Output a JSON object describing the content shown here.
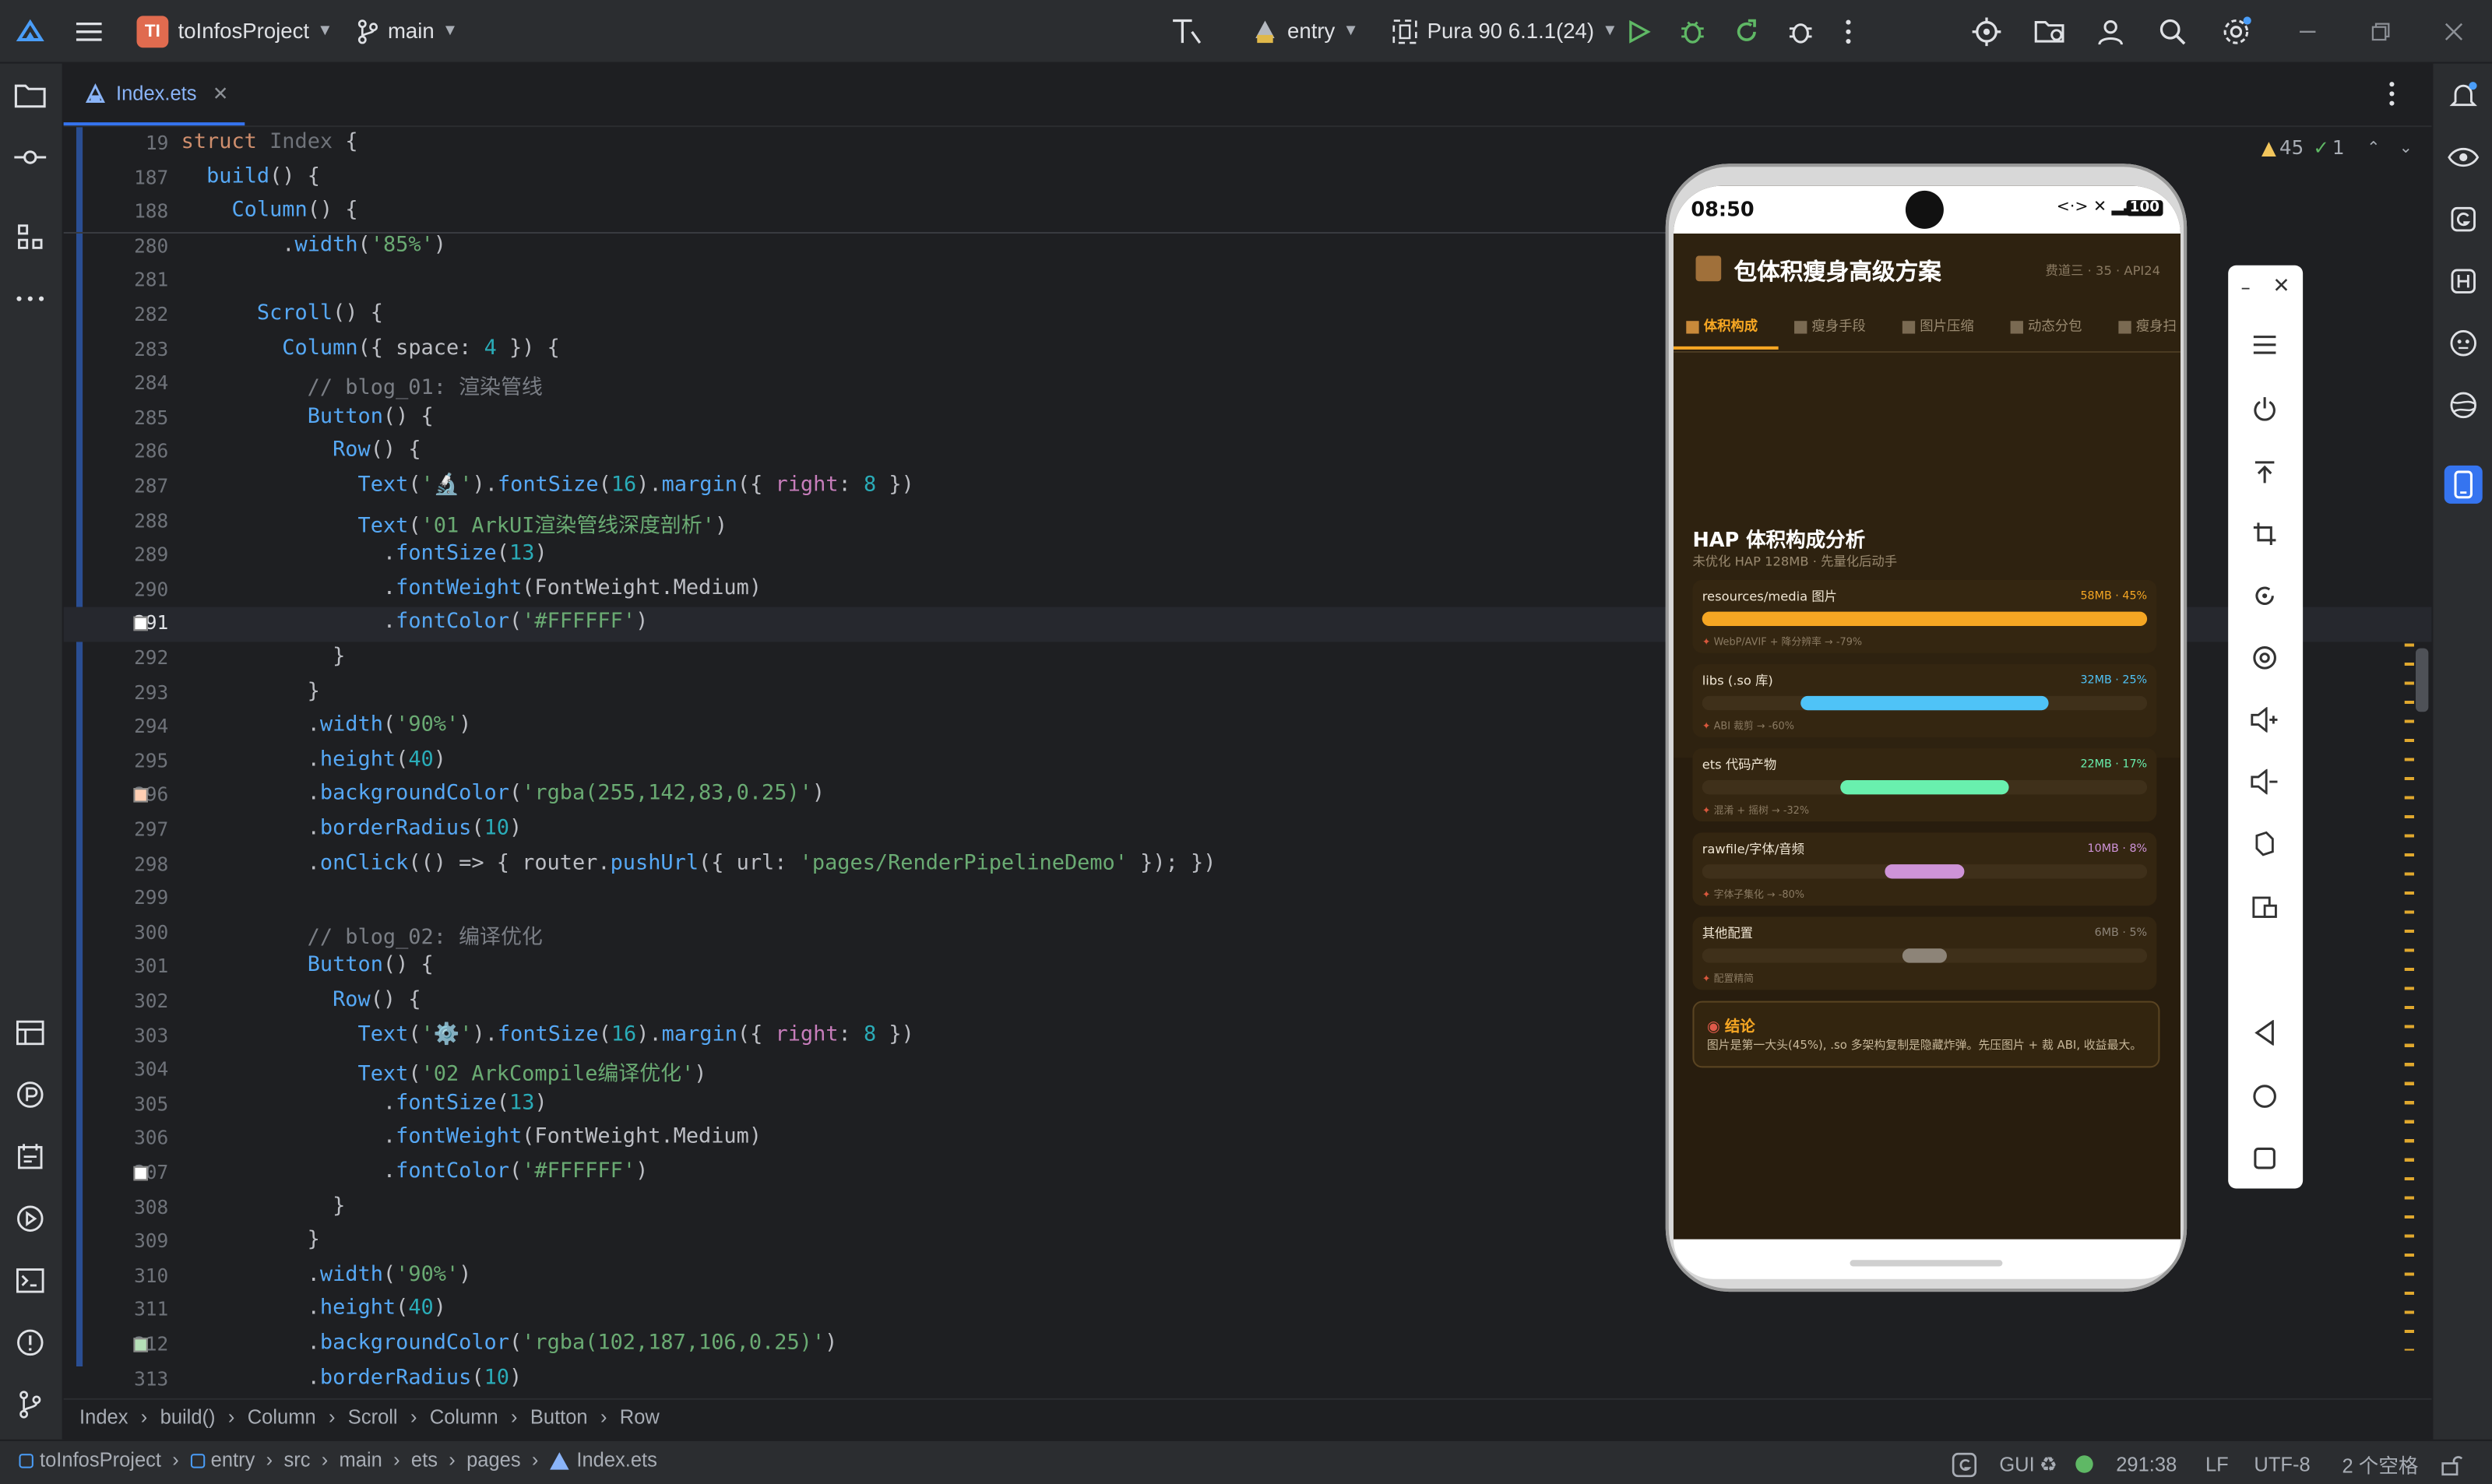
{
  "titlebar": {
    "project_badge": "TI",
    "project_name": "toInfosProject",
    "branch": "main",
    "run_config": "entry",
    "device": "Pura 90 6.1.1(24)"
  },
  "tab": {
    "filename": "Index.ets"
  },
  "inspections": {
    "warnings": "45",
    "weak_warnings": "1"
  },
  "code": {
    "lines": [
      {
        "n": "19",
        "text": "struct Index {"
      },
      {
        "n": "187",
        "text": "  build() {"
      },
      {
        "n": "188",
        "text": "    Column() {"
      },
      {
        "n": "280",
        "text": "        .width('85%')"
      },
      {
        "n": "281",
        "text": ""
      },
      {
        "n": "282",
        "text": "      Scroll() {"
      },
      {
        "n": "283",
        "text": "        Column({ space: 4 }) {"
      },
      {
        "n": "284",
        "text": "          // blog_01: 渲染管线"
      },
      {
        "n": "285",
        "text": "          Button() {"
      },
      {
        "n": "286",
        "text": "            Row() {"
      },
      {
        "n": "287",
        "text": "              Text('🔬').fontSize(16).margin({ right: 8 })"
      },
      {
        "n": "288",
        "text": "              Text('01 ArkUI渲染管线深度剖析')"
      },
      {
        "n": "289",
        "text": "                .fontSize(13)"
      },
      {
        "n": "290",
        "text": "                .fontWeight(FontWeight.Medium)"
      },
      {
        "n": "291",
        "text": "                .fontColor('#FFFFFF')"
      },
      {
        "n": "292",
        "text": "            }"
      },
      {
        "n": "293",
        "text": "          }"
      },
      {
        "n": "294",
        "text": "          .width('90%')"
      },
      {
        "n": "295",
        "text": "          .height(40)"
      },
      {
        "n": "296",
        "text": "          .backgroundColor('rgba(255,142,83,0.25)')"
      },
      {
        "n": "297",
        "text": "          .borderRadius(10)"
      },
      {
        "n": "298",
        "text": "          .onClick(() => { router.pushUrl({ url: 'pages/RenderPipelineDemo' }); })"
      },
      {
        "n": "299",
        "text": ""
      },
      {
        "n": "300",
        "text": "          // blog_02: 编译优化"
      },
      {
        "n": "301",
        "text": "          Button() {"
      },
      {
        "n": "302",
        "text": "            Row() {"
      },
      {
        "n": "303",
        "text": "              Text('⚙️').fontSize(16).margin({ right: 8 })"
      },
      {
        "n": "304",
        "text": "              Text('02 ArkCompile编译优化')"
      },
      {
        "n": "305",
        "text": "                .fontSize(13)"
      },
      {
        "n": "306",
        "text": "                .fontWeight(FontWeight.Medium)"
      },
      {
        "n": "307",
        "text": "                .fontColor('#FFFFFF')"
      },
      {
        "n": "308",
        "text": "            }"
      },
      {
        "n": "309",
        "text": "          }"
      },
      {
        "n": "310",
        "text": "          .width('90%')"
      },
      {
        "n": "311",
        "text": "          .height(40)"
      },
      {
        "n": "312",
        "text": "          .backgroundColor('rgba(102,187,106,0.25)')"
      },
      {
        "n": "313",
        "text": "          .borderRadius(10)"
      }
    ]
  },
  "breadcrumb": [
    "Index",
    "build()",
    "Column",
    "Scroll",
    "Column",
    "Button",
    "Row"
  ],
  "statusbar": {
    "path": [
      "toInfosProject",
      "entry",
      "src",
      "main",
      "ets",
      "pages",
      "Index.ets"
    ],
    "gui": "GUI",
    "cursor": "291:38",
    "line_sep": "LF",
    "encoding": "UTF-8",
    "indent": "2 个空格"
  },
  "phone": {
    "time": "08:50",
    "battery": "100",
    "app_title": "包体积瘦身高级方案",
    "app_meta": "费道三 · 35 · API24",
    "tabs": [
      "体积构成",
      "瘦身手段",
      "图片压缩",
      "动态分包",
      "瘦身扫"
    ],
    "section_title": "HAP 体积构成分析",
    "section_sub": "未优化 HAP 128MB · 先量化后动手",
    "rows": [
      {
        "label": "resources/media 图片",
        "value": "58MB · 45%",
        "tip": "WebP/AVIF + 降分辨率 → -79%",
        "color": "#f5a623",
        "start": 0.0,
        "end": 1.0
      },
      {
        "label": "libs (.so 库)",
        "value": "32MB · 25%",
        "tip": "ABI 裁剪 → -60%",
        "color": "#4fc3f7",
        "start": 0.22,
        "end": 0.78
      },
      {
        "label": "ets 代码产物",
        "value": "22MB · 17%",
        "tip": "混淆 + 摇树 → -32%",
        "color": "#69f0ae",
        "start": 0.31,
        "end": 0.69
      },
      {
        "label": "rawfile/字体/音频",
        "value": "10MB · 8%",
        "tip": "字体子集化 → -80%",
        "color": "#ce93d8",
        "start": 0.41,
        "end": 0.59
      },
      {
        "label": "其他配置",
        "value": "6MB · 5%",
        "tip": "配置精简",
        "color": "#8d8478",
        "start": 0.45,
        "end": 0.55
      }
    ],
    "conclusion_title": "结论",
    "conclusion_text": "图片是第一大头(45%), .so 多架构复制是隐藏炸弹。先压图片 + 裁 ABI, 收益最大。"
  },
  "colors": {
    "accent_orange": "#f5a623",
    "ide_bg": "#1e1f22",
    "panel_bg": "#2b2d30"
  }
}
